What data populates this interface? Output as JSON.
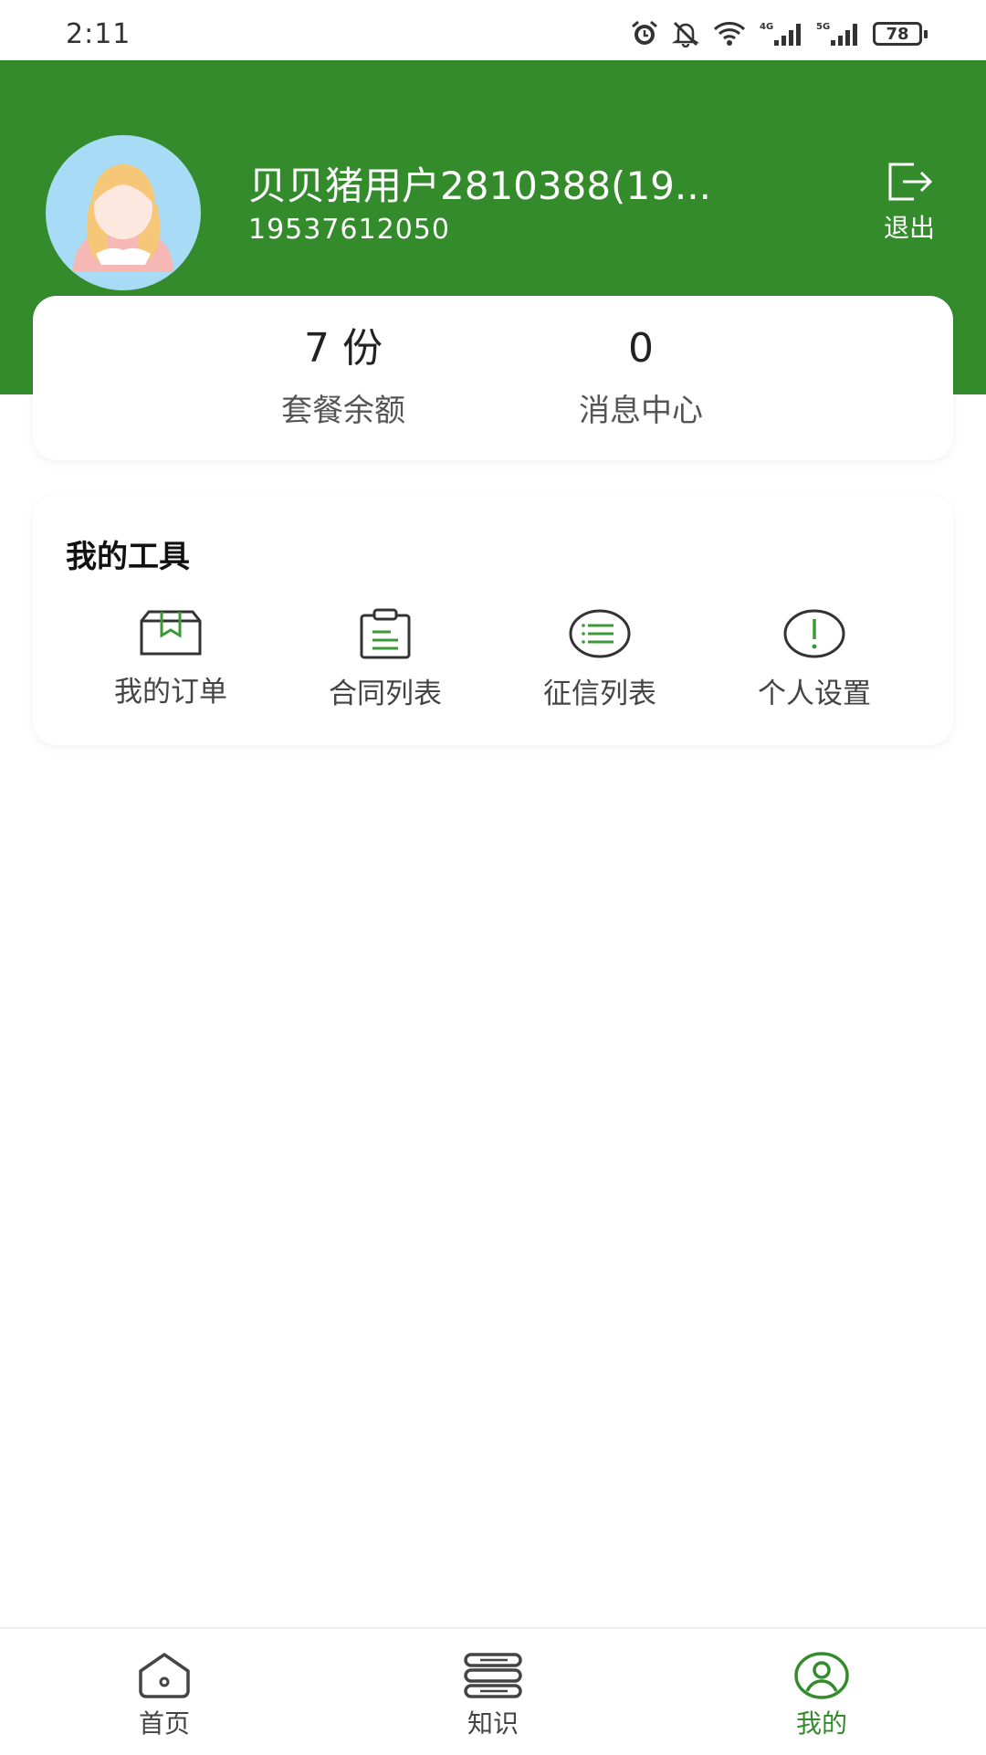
{
  "status_bar": {
    "time": "2:11",
    "battery": "78"
  },
  "header": {
    "user_name": "贝贝猪用户2810388(19...",
    "phone": "19537612050",
    "logout_label": "退出",
    "bg_color": "#348b2c"
  },
  "stats": [
    {
      "value": "7 份",
      "label": "套餐余额"
    },
    {
      "value": "0",
      "label": "消息中心"
    }
  ],
  "tools": {
    "title": "我的工具",
    "items": [
      {
        "label": "我的订单",
        "icon": "box-icon"
      },
      {
        "label": "合同列表",
        "icon": "clipboard-icon"
      },
      {
        "label": "征信列表",
        "icon": "list-icon"
      },
      {
        "label": "个人设置",
        "icon": "alert-icon"
      }
    ]
  },
  "bottom_nav": [
    {
      "label": "首页",
      "icon": "home-icon",
      "active": false
    },
    {
      "label": "知识",
      "icon": "knowledge-icon",
      "active": false
    },
    {
      "label": "我的",
      "icon": "user-icon",
      "active": true
    }
  ],
  "colors": {
    "accent": "#348b2c",
    "icon_green": "#3b9a35"
  }
}
